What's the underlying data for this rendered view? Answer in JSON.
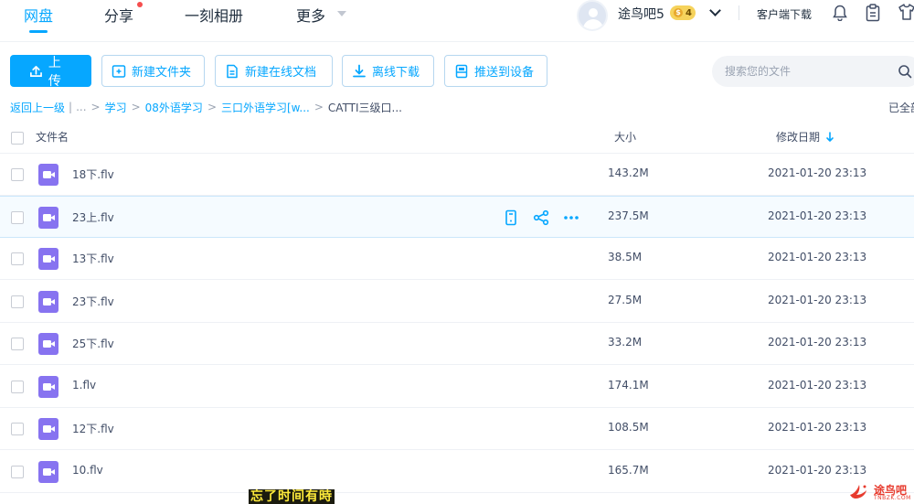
{
  "nav": {
    "tabs": [
      {
        "label": "网盘",
        "active": true
      },
      {
        "label": "分享",
        "active": false
      },
      {
        "label": "一刻相册",
        "active": false
      },
      {
        "label": "更多",
        "active": false
      }
    ],
    "username": "途鸟吧5",
    "vip_level": "4",
    "vip_symbol": "$",
    "client_download": "客户端下载"
  },
  "toolbar": {
    "upload": "上传",
    "new_folder": "新建文件夹",
    "new_online_doc": "新建在线文档",
    "offline_download": "离线下载",
    "push_to_device": "推送到设备",
    "search_placeholder": "搜索您的文件"
  },
  "breadcrumb": {
    "back": "返回上一级",
    "pipe": "|",
    "ellipsis": "...",
    "items": [
      "学习",
      "08外语学习",
      "三口外语学习[w...",
      "CATTI三级口..."
    ],
    "loaded_all": "已全部"
  },
  "table": {
    "col_name": "文件名",
    "col_size": "大小",
    "col_date": "修改日期",
    "rows": [
      {
        "name": "18下.flv",
        "size": "143.2M",
        "date": "2021-01-20 23:13"
      },
      {
        "name": "23上.flv",
        "size": "237.5M",
        "date": "2021-01-20 23:13"
      },
      {
        "name": "13下.flv",
        "size": "38.5M",
        "date": "2021-01-20 23:13"
      },
      {
        "name": "23下.flv",
        "size": "27.5M",
        "date": "2021-01-20 23:13"
      },
      {
        "name": "25下.flv",
        "size": "33.2M",
        "date": "2021-01-20 23:13"
      },
      {
        "name": "1.flv",
        "size": "174.1M",
        "date": "2021-01-20 23:13"
      },
      {
        "name": "12下.flv",
        "size": "108.5M",
        "date": "2021-01-20 23:13"
      },
      {
        "name": "10.flv",
        "size": "165.7M",
        "date": "2021-01-20 23:13"
      }
    ]
  },
  "overlay": {
    "subtitle": "忘了时间有時",
    "watermark": "途鸟吧",
    "watermark_sub": "TNBZK.COM"
  },
  "colors": {
    "accent": "#06a7ff",
    "video_icon": "#8773f0",
    "text": "#424e67"
  },
  "icons": {
    "upload": "upload-icon",
    "new_folder": "folder-plus-icon",
    "new_doc": "document-icon",
    "offline_download": "download-icon",
    "push_device": "device-icon",
    "search": "search-icon",
    "bell": "bell-icon",
    "clipboard": "clipboard-icon",
    "shirt": "shirt-icon",
    "sort": "arrow-down-icon",
    "video": "video-file-icon",
    "phone": "phone-icon",
    "share": "share-icon",
    "more": "more-icon"
  }
}
